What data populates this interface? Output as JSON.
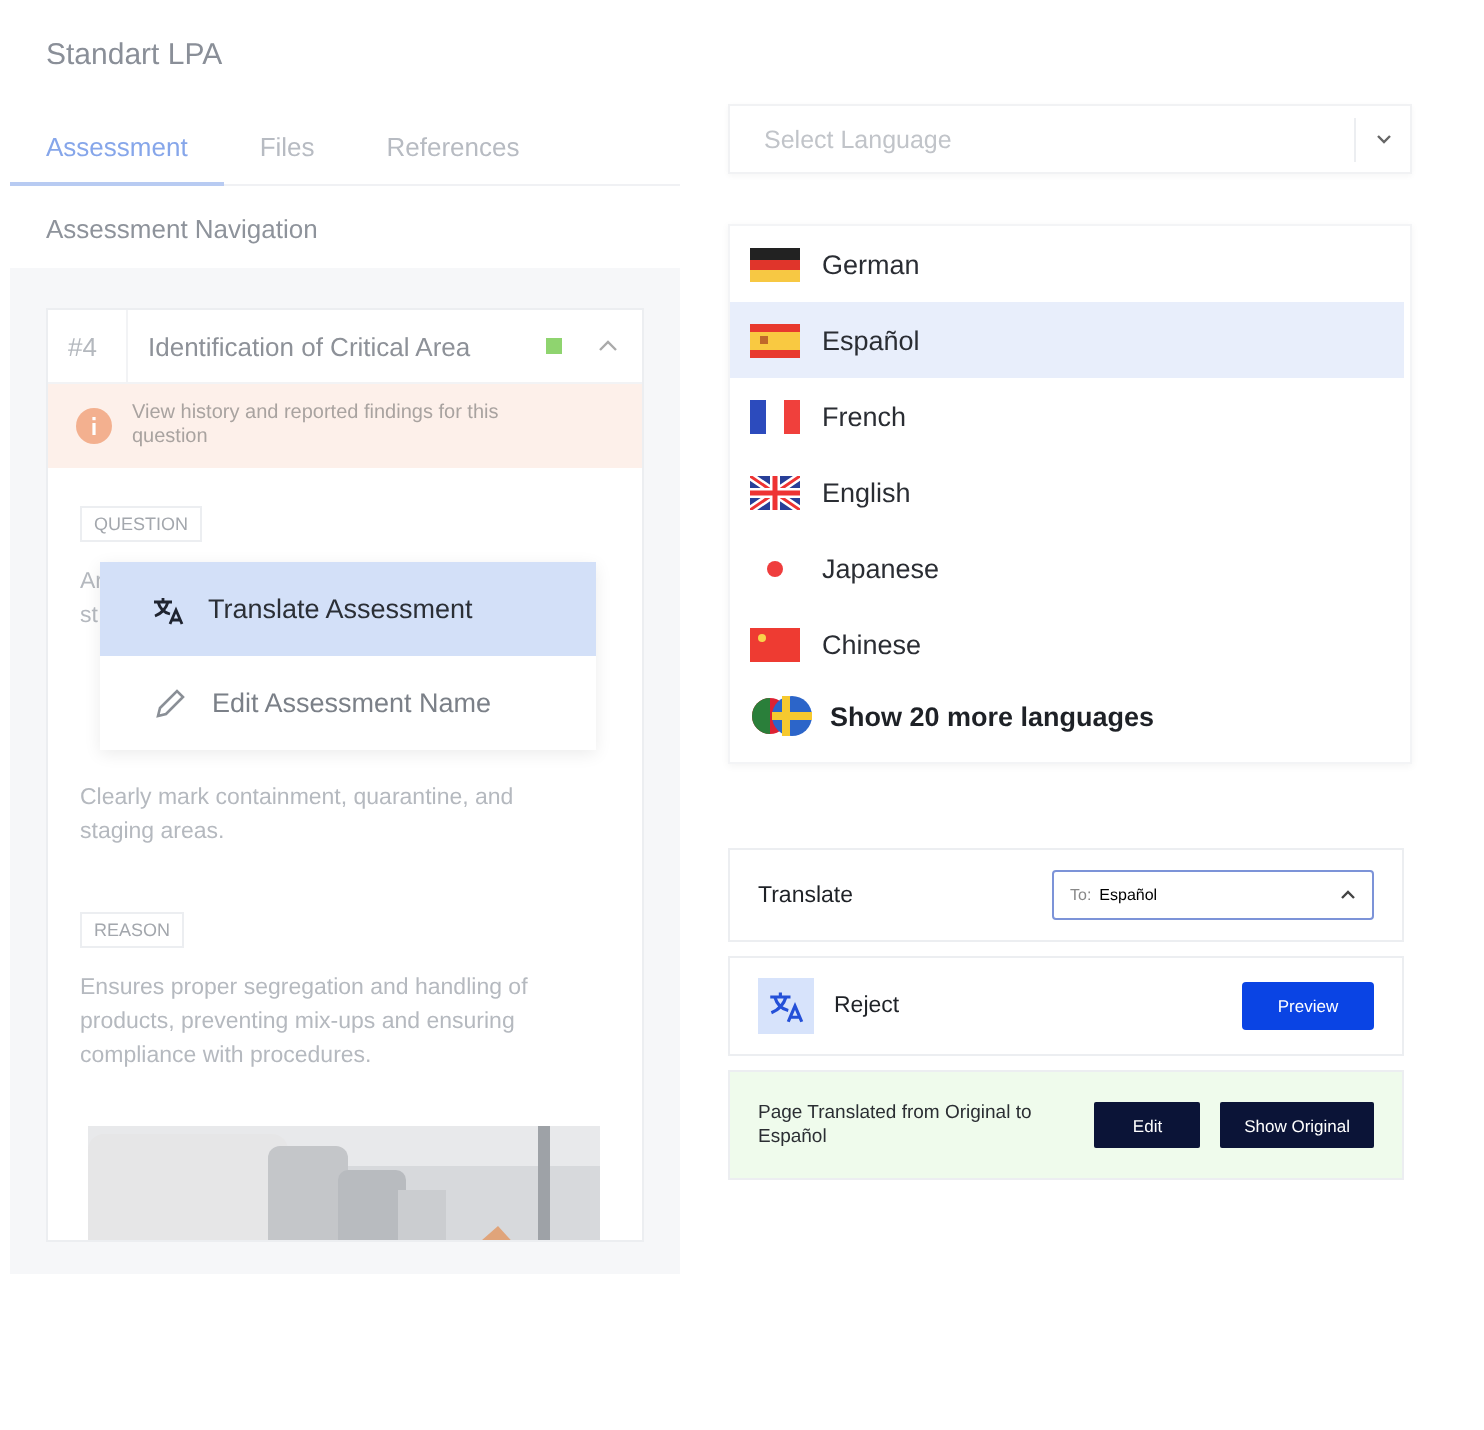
{
  "left_panel": {
    "title": "Standart LPA",
    "tabs": [
      {
        "label": "Assessment",
        "selected": true
      },
      {
        "label": "Files",
        "selected": false
      },
      {
        "label": "References",
        "selected": false
      }
    ],
    "section_title": "Assessment Navigation",
    "question_card": {
      "number": "#4",
      "title": "Identification of Critical Area",
      "completed": true,
      "expanded": true,
      "notice": "View history and reported findings for this question",
      "question_label": "QUESTION",
      "question_text_lines": [
        "Ar",
        "st"
      ],
      "answer_text": "Clearly mark containment, quarantine, and staging areas.",
      "reason_label": "REASON",
      "reason_text": "Ensures proper segregation and handling of products, preventing mix-ups and ensuring compliance with procedures.",
      "image": {
        "kind": "picture"
      }
    },
    "context_menu": [
      {
        "label": "Translate Assessment",
        "kind": "translate",
        "selected": true
      },
      {
        "label": "Edit Assessment Name",
        "kind": "edit",
        "selected": false
      }
    ]
  },
  "language_select": {
    "placeholder": "Select Language"
  },
  "language_list": [
    {
      "label": "German",
      "selected": false
    },
    {
      "label": "Español",
      "selected": true
    },
    {
      "label": "French",
      "selected": false
    },
    {
      "label": "English",
      "selected": false
    },
    {
      "label": "Japanese",
      "selected": false
    },
    {
      "label": "Chinese",
      "selected": false
    }
  ],
  "more_languages": "Show 20 more languages",
  "translate_bar": {
    "label": "Translate",
    "target_prefix": "To:",
    "target_value": "Español",
    "open": true
  },
  "reject_bar": {
    "label": "Reject",
    "button": "Preview"
  },
  "translated_banner": {
    "message": "Page Translated from Original to Español",
    "buttons": [
      "Edit",
      "Show Original"
    ]
  }
}
